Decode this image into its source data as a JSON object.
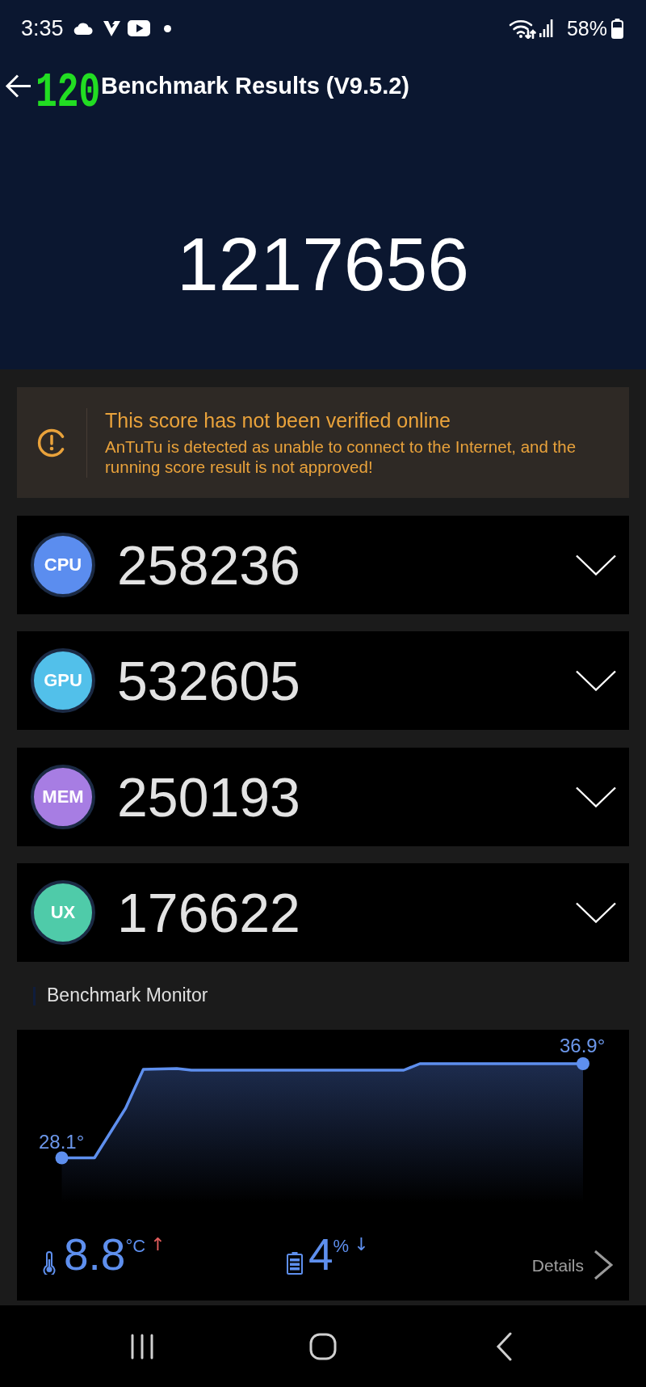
{
  "status_bar": {
    "time": "3:35",
    "battery": "58%"
  },
  "fps_counter": "120",
  "header": {
    "title": "Benchmark Results (V9.5.2)"
  },
  "total_score": "1217656",
  "warning": {
    "title": "This score has not been verified online",
    "message": "AnTuTu is detected as unable to connect to the Internet, and the running score result is not approved!"
  },
  "scores": [
    {
      "label": "CPU",
      "score": "258236",
      "color": "#5b8def",
      "expanded": false
    },
    {
      "label": "GPU",
      "score": "532605",
      "color": "#52c0ea",
      "expanded": false
    },
    {
      "label": "MEM",
      "score": "250193",
      "color": "#a77de3",
      "expanded": false
    },
    {
      "label": "UX",
      "score": "176622",
      "color": "#4fcba9",
      "expanded": false
    }
  ],
  "monitor": {
    "title": "Benchmark Monitor",
    "start_label": "28.1°",
    "end_label": "36.9°",
    "temperature": {
      "value": "8.8",
      "unit": "°C",
      "trend": "↑"
    },
    "battery": {
      "value": "4",
      "unit": "%",
      "trend": "↓"
    },
    "details": "Details"
  }
}
